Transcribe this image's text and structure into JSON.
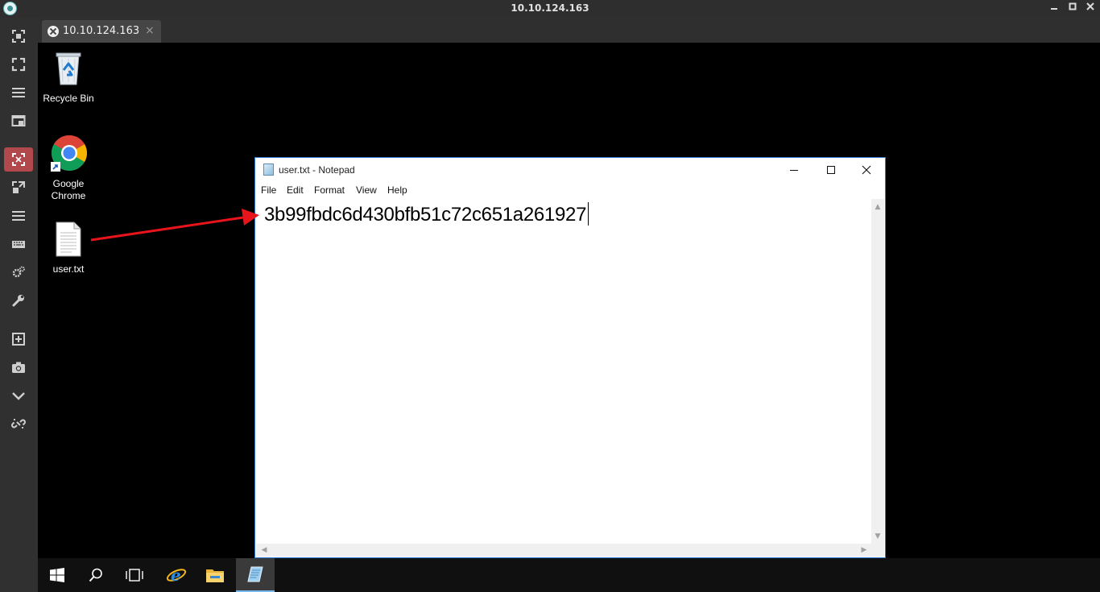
{
  "window": {
    "title": "10.10.124.163"
  },
  "tab": {
    "label": "10.10.124.163",
    "close_glyph": "×"
  },
  "sidebar": {
    "items": [
      {
        "icon": "screenshot-region-icon"
      },
      {
        "icon": "fullscreen-icon"
      },
      {
        "icon": "menu-lines-icon"
      },
      {
        "icon": "window-layout-icon"
      },
      {
        "icon": "fit-screen-icon",
        "active": true
      },
      {
        "icon": "scale-icon"
      },
      {
        "icon": "menu-lines-icon"
      },
      {
        "icon": "keyboard-icon"
      },
      {
        "icon": "settings-gears-icon"
      },
      {
        "icon": "wrench-icon"
      },
      {
        "icon": "new-window-icon"
      },
      {
        "icon": "camera-icon"
      },
      {
        "icon": "chevron-down-icon"
      },
      {
        "icon": "disconnect-link-icon"
      }
    ],
    "active_color": "#b0484c"
  },
  "desktop": {
    "icons": [
      {
        "label": "Recycle Bin",
        "icon": "recycle-bin-icon"
      },
      {
        "label": "Google\nChrome",
        "label_line1": "Google",
        "label_line2": "Chrome",
        "icon": "chrome-icon"
      },
      {
        "label": "user.txt",
        "icon": "text-file-icon"
      }
    ]
  },
  "notepad": {
    "title": "user.txt - Notepad",
    "menu": [
      "File",
      "Edit",
      "Format",
      "View",
      "Help"
    ],
    "content": "3b99fbdc6d430bfb51c72c651a261927",
    "border_color": "#2b79d6"
  },
  "annotation": {
    "arrow_color": "#e8141b"
  },
  "taskbar": {
    "items": [
      {
        "icon": "windows-start-icon"
      },
      {
        "icon": "search-icon"
      },
      {
        "icon": "task-view-icon"
      },
      {
        "icon": "internet-explorer-icon"
      },
      {
        "icon": "file-explorer-icon"
      },
      {
        "icon": "notepad-icon",
        "active": true
      }
    ]
  }
}
